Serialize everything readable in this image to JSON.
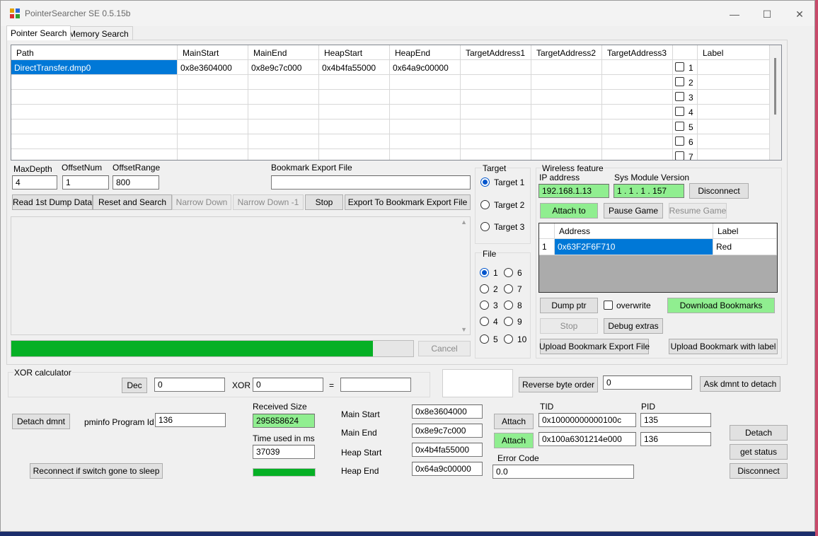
{
  "app": {
    "title": "PointerSearcher SE 0.5.15b"
  },
  "window_controls": {
    "minimize": "—",
    "maximize": "☐",
    "close": "✕"
  },
  "tabs": [
    "Pointer Search",
    "Memory Search"
  ],
  "dump_grid": {
    "columns": [
      "Path",
      "MainStart",
      "MainEnd",
      "HeapStart",
      "HeapEnd",
      "TargetAddress1",
      "TargetAddress2",
      "TargetAddress3",
      "",
      "Label"
    ],
    "rows": [
      {
        "path": "DirectTransfer.dmp0",
        "main_start": "0x8e3604000",
        "main_end": "0x8e9c7c000",
        "heap_start": "0x4b4fa55000",
        "heap_end": "0x64a9c00000",
        "t1": "",
        "t2": "",
        "t3": "",
        "num": "1",
        "label": ""
      },
      {
        "path": "",
        "main_start": "",
        "main_end": "",
        "heap_start": "",
        "heap_end": "",
        "t1": "",
        "t2": "",
        "t3": "",
        "num": "2",
        "label": ""
      },
      {
        "path": "",
        "main_start": "",
        "main_end": "",
        "heap_start": "",
        "heap_end": "",
        "t1": "",
        "t2": "",
        "t3": "",
        "num": "3",
        "label": ""
      },
      {
        "path": "",
        "main_start": "",
        "main_end": "",
        "heap_start": "",
        "heap_end": "",
        "t1": "",
        "t2": "",
        "t3": "",
        "num": "4",
        "label": ""
      },
      {
        "path": "",
        "main_start": "",
        "main_end": "",
        "heap_start": "",
        "heap_end": "",
        "t1": "",
        "t2": "",
        "t3": "",
        "num": "5",
        "label": ""
      },
      {
        "path": "",
        "main_start": "",
        "main_end": "",
        "heap_start": "",
        "heap_end": "",
        "t1": "",
        "t2": "",
        "t3": "",
        "num": "6",
        "label": ""
      },
      {
        "path": "",
        "main_start": "",
        "main_end": "",
        "heap_start": "",
        "heap_end": "",
        "t1": "",
        "t2": "",
        "t3": "",
        "num": "7",
        "label": ""
      }
    ]
  },
  "search": {
    "max_depth_label": "MaxDepth",
    "max_depth": "4",
    "offset_num_label": "OffsetNum",
    "offset_num": "1",
    "offset_range_label": "OffsetRange",
    "offset_range": "800",
    "bookmark_export_label": "Bookmark Export File",
    "bookmark_export_value": ""
  },
  "actions": {
    "read_dump": "Read 1st Dump Data",
    "reset_search": "Reset and Search",
    "narrow_down": "Narrow Down",
    "narrow_down_1": "Narrow Down -1",
    "stop": "Stop",
    "export": "Export To Bookmark Export File",
    "cancel": "Cancel"
  },
  "search_progress": 0.9,
  "target_group": {
    "title": "Target",
    "options": [
      "Target 1",
      "Target 2",
      "Target 3"
    ],
    "selected": "Target 1"
  },
  "file_group": {
    "title": "File",
    "options": [
      "1",
      "2",
      "3",
      "4",
      "5",
      "6",
      "7",
      "8",
      "9",
      "10"
    ],
    "selected": "1"
  },
  "wireless": {
    "title": "Wireless feature",
    "ip_label": "IP address",
    "ip": "192.168.1.13",
    "sysmod_label": "Sys Module Version",
    "sysmod": "1 . 1 . 1 . 157",
    "disconnect": "Disconnect",
    "attach_to": "Attach to",
    "pause_game": "Pause Game",
    "resume_game": "Resume Game",
    "bookmarks": {
      "columns": [
        "Address",
        "Label"
      ],
      "rows": [
        {
          "num": "1",
          "address": "0x63F2F6F710",
          "label": "Red"
        }
      ]
    },
    "dump_ptr": "Dump ptr",
    "overwrite": "overwrite",
    "download_bookmarks": "Download Bookmarks",
    "stop": "Stop",
    "debug_extras": "Debug extras",
    "upload_bookmark_export": "Upload Bookmark Export File",
    "upload_bookmark_label": "Upload Bookmark with label"
  },
  "xor": {
    "title": "XOR calculator",
    "mode_button": "Dec",
    "input_a": "0",
    "xor_label": "XOR",
    "input_b": "0",
    "equals": "=",
    "result": ""
  },
  "byte_order": {
    "reverse_button": "Reverse byte order",
    "value": "0",
    "ask_detach": "Ask dmnt to detach"
  },
  "bottom": {
    "detach_dmnt": "Detach dmnt",
    "pminfo_label": "pminfo Program Id",
    "pminfo_value": "136",
    "reconnect": "Reconnect if switch gone to sleep",
    "received_label": "Received Size",
    "received_value": "295858624",
    "time_label": "Time used in ms",
    "time_value": "37039",
    "transfer_progress": 1.0,
    "main_start_label": "Main Start",
    "main_start": "0x8e3604000",
    "main_end_label": "Main End",
    "main_end": "0x8e9c7c000",
    "heap_start_label": "Heap Start",
    "heap_start": "0x4b4fa55000",
    "heap_end_label": "Heap End",
    "heap_end": "0x64a9c00000",
    "attach1": "Attach",
    "attach2": "Attach",
    "tid_label": "TID",
    "tid1": "0x10000000000100c",
    "tid2": "0x100a6301214e000",
    "pid_label": "PID",
    "pid1": "135",
    "pid2": "136",
    "error_label": "Error Code",
    "error_value": "0.0",
    "detach": "Detach",
    "get_status": "get status",
    "disconnect": "Disconnect"
  },
  "colors": {
    "accent": "#0078d7",
    "active_green": "#90ee90",
    "progress_green": "#06b025"
  },
  "icons": {
    "app": "app-grid-icon",
    "scroll_up": "▲",
    "scroll_down": "▼"
  }
}
